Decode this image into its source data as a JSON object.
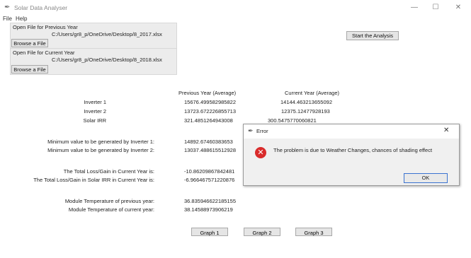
{
  "window": {
    "title": "Solar Data Analyser",
    "minimize": "—",
    "maximize": "☐",
    "close": "✕"
  },
  "menu": [
    "File",
    "Help"
  ],
  "previous_file": {
    "label": "Open File for Previous Year",
    "path": "C:/Users/gr8_p/OneDrive/Desktop/8_2017.xlsx",
    "browse": "Browse a File"
  },
  "current_file": {
    "label": "Open File for Current Year",
    "path": "C:/Users/gr8_p/OneDrive/Desktop/8_2018.xlsx",
    "browse": "Browse a File"
  },
  "start_button": "Start the Analysis",
  "averages": {
    "headers": [
      "Previous Year (Average)",
      "Current Year (Average)"
    ],
    "rows": [
      {
        "label": "Inverter 1",
        "previous": "15676.499582985822",
        "current": "14144.463213655092"
      },
      {
        "label": "Inverter 2",
        "previous": "13723.672226855713",
        "current": "12375.12477928193"
      },
      {
        "label": "Solar IRR",
        "previous": "321.4851264943008",
        "current": "300.5475770060821"
      }
    ]
  },
  "minimums": [
    {
      "label": "Minimum value to be generated by Inverter 1:",
      "value": "14892.67460383653"
    },
    {
      "label": "Minimum value to be generated by Inverter 2:",
      "value": "13037.488615512928"
    }
  ],
  "loss_gain": [
    {
      "label": "The Total Loss/Gain in Current Year is:",
      "value": "-10.86209867842481"
    },
    {
      "label": "The Total Loss/Gain in Solar IRR in Current Year is:",
      "value": "-6.966467571220876"
    }
  ],
  "module_temp": [
    {
      "label": "Module Temperature of previous year:",
      "value": "36.835946622185155"
    },
    {
      "label": "Module Temperature of current year:",
      "value": "38.14588973906219"
    }
  ],
  "graph_buttons": [
    "Graph 1",
    "Graph 2",
    "Graph 3"
  ],
  "dialog": {
    "title": "Error",
    "close": "✕",
    "message": "The problem is due to Weather Changes, chances of shading effect",
    "ok": "OK"
  }
}
